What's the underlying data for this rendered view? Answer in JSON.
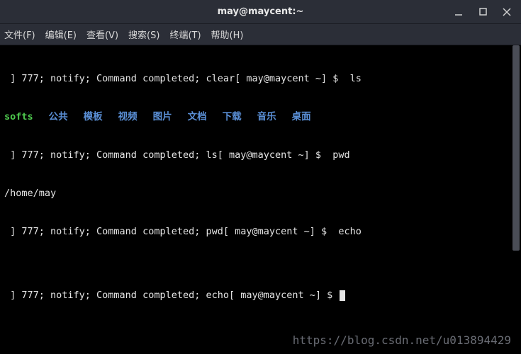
{
  "titlebar": {
    "title": "may@maycent:~"
  },
  "menubar": {
    "items": [
      "文件(F)",
      "编辑(E)",
      "查看(V)",
      "搜索(S)",
      "终端(T)",
      "帮助(H)"
    ]
  },
  "terminal": {
    "lines": {
      "l0": " ] 777; notify; Command completed; clear[ may@maycent ~] $  ls",
      "l2": " ] 777; notify; Command completed; ls[ may@maycent ~] $  pwd",
      "l3": "/home/may",
      "l4": " ] 777; notify; Command completed; pwd[ may@maycent ~] $  echo",
      "l5": "",
      "l6": " ] 777; notify; Command completed; echo[ may@maycent ~] $ "
    },
    "ls_output": {
      "softs": "softs",
      "gonggong": "公共",
      "muban": "模板",
      "shipin": "视频",
      "tupian": "图片",
      "wendang": "文档",
      "xiazai": "下载",
      "yinyue": "音乐",
      "zhuomian": "桌面"
    }
  },
  "watermark": "https://blog.csdn.net/u013894429"
}
